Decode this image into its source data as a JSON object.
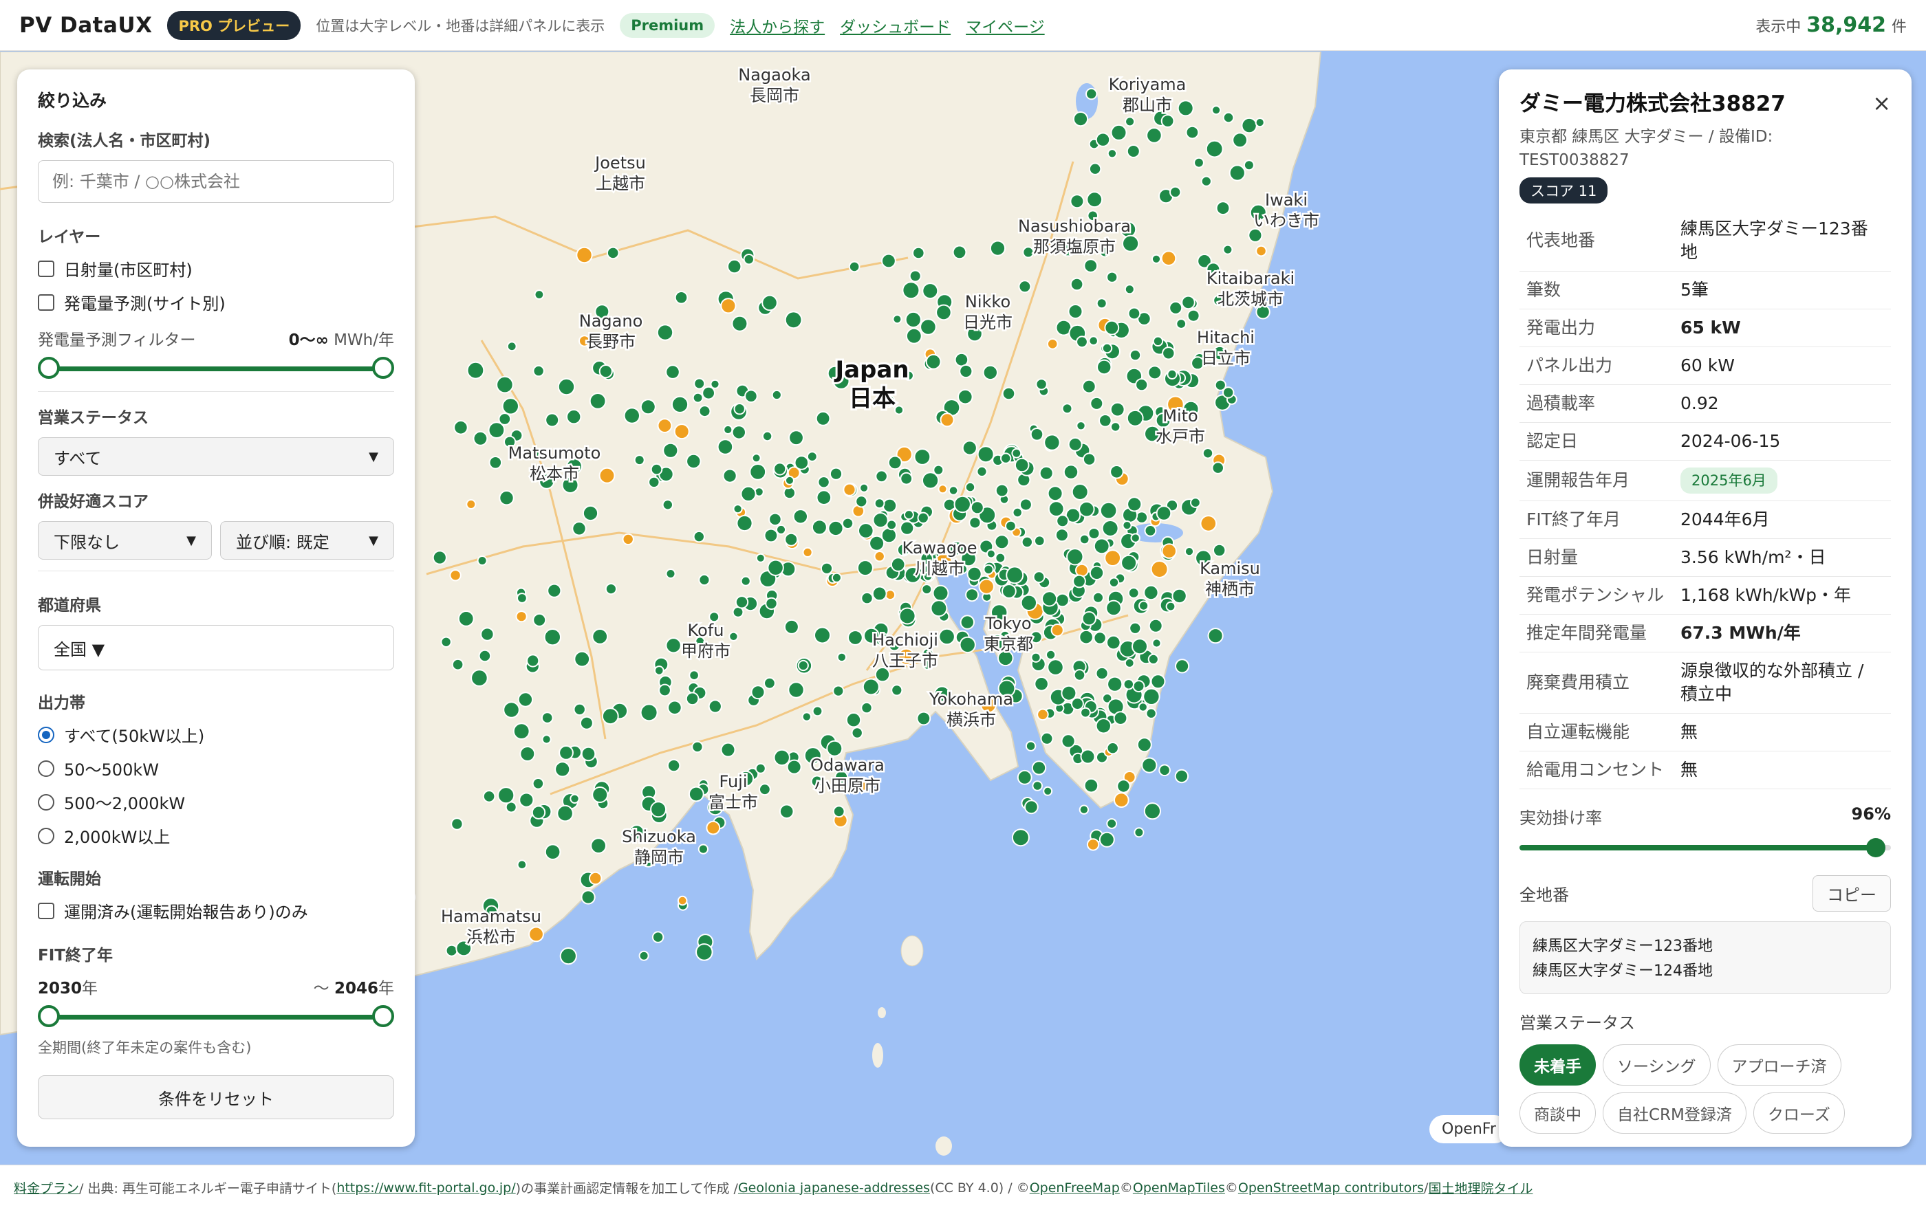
{
  "header": {
    "brand": "PV DataUX",
    "pro_badge": "PRO プレビュー",
    "note": "位置は大字レベル・地番は詳細パネルに表示",
    "premium_badge": "Premium",
    "links": [
      "法人から探す",
      "ダッシュボード",
      "マイページ"
    ],
    "count_label": "表示中",
    "count_value": "38,942",
    "count_unit": "件"
  },
  "map": {
    "country_en": "Japan",
    "country_ja": "日本",
    "cities": [
      {
        "en": "Nagaoka",
        "ja": "長岡市"
      },
      {
        "en": "Koriyama",
        "ja": "郡山市"
      },
      {
        "en": "Joetsu",
        "ja": "上越市"
      },
      {
        "en": "Iwaki",
        "ja": "いわき市"
      },
      {
        "en": "Nasushiobara",
        "ja": "那須塩原市"
      },
      {
        "en": "Kitaibaraki",
        "ja": "北茨城市"
      },
      {
        "en": "Nagano",
        "ja": "長野市"
      },
      {
        "en": "Nikko",
        "ja": "日光市"
      },
      {
        "en": "Hitachi",
        "ja": "日立市"
      },
      {
        "en": "Matsumoto",
        "ja": "松本市"
      },
      {
        "en": "Mito",
        "ja": "水戸市"
      },
      {
        "en": "Kawagoe",
        "ja": "川越市"
      },
      {
        "en": "Kamisu",
        "ja": "神栖市"
      },
      {
        "en": "Kofu",
        "ja": "甲府市"
      },
      {
        "en": "Hachioji",
        "ja": "八王子市"
      },
      {
        "en": "Tokyo",
        "ja": "東京都"
      },
      {
        "en": "Yokohama",
        "ja": "横浜市"
      },
      {
        "en": "Odawara",
        "ja": "小田原市"
      },
      {
        "en": "Fuji",
        "ja": "富士市"
      },
      {
        "en": "Shizuoka",
        "ja": "静岡市"
      },
      {
        "en": "Hamamatsu",
        "ja": "浜松市"
      }
    ],
    "attribution_tag": "OpenFr"
  },
  "filters": {
    "title": "絞り込み",
    "search": {
      "label": "検索(法人名・市区町村)",
      "placeholder": "例: 千葉市 / ○○株式会社",
      "value": ""
    },
    "layers": {
      "label": "レイヤー",
      "items": [
        "日射量(市区町村)",
        "発電量予測(サイト別)"
      ]
    },
    "generation_filter": {
      "label": "発電量予測フィルター",
      "range_value": "0〜∞",
      "unit": "MWh/年"
    },
    "status": {
      "label": "営業ステータス",
      "selected": "すべて"
    },
    "score": {
      "label": "併設好適スコア",
      "min_selected": "下限なし",
      "sort_selected": "並び順: 既定"
    },
    "prefecture": {
      "label": "都道府県",
      "selected": "全国 ▼"
    },
    "capacity": {
      "label": "出力帯",
      "options": [
        "すべて(50kW以上)",
        "50〜500kW",
        "500〜2,000kW",
        "2,000kW以上"
      ],
      "selected_index": 0
    },
    "operation": {
      "label": "運転開始",
      "checkbox": "運開済み(運転開始報告あり)のみ"
    },
    "fit_end": {
      "label": "FIT終了年",
      "from": "2030",
      "from_unit": "年",
      "to_prefix": "〜",
      "to": "2046",
      "to_unit": "年",
      "note": "全期間(終了年未定の案件も含む)"
    },
    "reset_label": "条件をリセット"
  },
  "detail": {
    "title": "ダミー電力株式会社38827",
    "address": "東京都 練馬区 大字ダミー / 設備ID: TEST0038827",
    "score_badge": "スコア 11",
    "close_icon": "×",
    "rows": [
      {
        "k": "代表地番",
        "v": "練馬区大字ダミー123番地"
      },
      {
        "k": "筆数",
        "v": "5筆"
      },
      {
        "k": "発電出力",
        "v": "65 kW"
      },
      {
        "k": "パネル出力",
        "v": "60 kW"
      },
      {
        "k": "過積載率",
        "v": "0.92"
      },
      {
        "k": "認定日",
        "v": "2024-06-15"
      },
      {
        "k": "運開報告年月",
        "v": "2025年6月"
      },
      {
        "k": "FIT終了年月",
        "v": "2044年6月"
      },
      {
        "k": "日射量",
        "v": "3.56 kWh/m²・日"
      },
      {
        "k": "発電ポテンシャル",
        "v": "1,168 kWh/kWp・年"
      },
      {
        "k": "推定年間発電量",
        "v": "67.3 MWh/年"
      },
      {
        "k": "廃棄費用積立",
        "v": "源泉徴収的な外部積立 / 積立中"
      },
      {
        "k": "自立運転機能",
        "v": "無"
      },
      {
        "k": "給電用コンセント",
        "v": "無"
      }
    ],
    "efficiency": {
      "label": "実効掛け率",
      "value_text": "96%",
      "value": 0.96
    },
    "lots": {
      "label": "全地番",
      "copy_label": "コピー",
      "lines": [
        "練馬区大字ダミー123番地",
        "練馬区大字ダミー124番地"
      ]
    },
    "status": {
      "label": "営業ステータス",
      "chips": [
        "未着手",
        "ソーシング",
        "アプローチ済",
        "商談中",
        "自社CRM登録済",
        "クローズ"
      ],
      "selected_index": 0
    }
  },
  "footer": {
    "pricing": "料金プラン",
    "source_prefix": " / 出典: 再生可能エネルギー電子申請サイト(",
    "source_link": "https://www.fit-portal.go.jp/",
    "source_suffix": ")の事業計画認定情報を加工して作成 / ",
    "geolonia": "Geolonia japanese-addresses",
    "ccby": " (CC BY 4.0) / © ",
    "openfreemap": "OpenFreeMap",
    "copy1": " © ",
    "openmaptiles": "OpenMapTiles",
    "copy2": " © ",
    "osm": "OpenStreetMap contributors",
    "sep": " / ",
    "gsi": "国土地理院タイル"
  },
  "colors": {
    "accent": "#1a7a3a",
    "sea": "#9fc1f5",
    "land": "#f3efe2",
    "marker": "#1f8a48",
    "marker_orange": "#f0a020"
  }
}
